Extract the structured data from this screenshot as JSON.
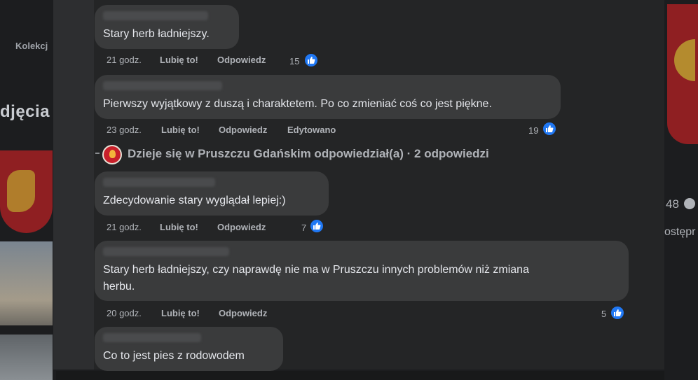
{
  "background": {
    "left_nav": {
      "kolekcje": "Kolekcj",
      "zdjecia": "djęcia"
    },
    "right": {
      "count": "48",
      "label": "ostępr"
    }
  },
  "comments": [
    {
      "text": "Stary herb ładniejszy.",
      "time": "21 godz.",
      "like": "Lubię to!",
      "reply": "Odpowiedz",
      "edited": "",
      "reactions": "15"
    },
    {
      "text": "Pierwszy wyjątkowy z duszą i charaktetem. Po co zmieniać coś co jest piękne.",
      "time": "23 godz.",
      "like": "Lubię to!",
      "reply": "Odpowiedz",
      "edited": "Edytowano",
      "reactions": "19"
    },
    {
      "text": "Zdecydowanie stary wyglądał lepiej:)",
      "time": "21 godz.",
      "like": "Lubię to!",
      "reply": "Odpowiedz",
      "edited": "",
      "reactions": "7"
    },
    {
      "text_line1": "Stary herb ładniejszy, czy naprawdę nie ma w Pruszczu innych problemów niż zmiana",
      "text_line2": "herbu.",
      "time": "20 godz.",
      "like": "Lubię to!",
      "reply": "Odpowiedz",
      "edited": "",
      "reactions": "5"
    },
    {
      "text": "Co to jest pies z rodowodem"
    }
  ],
  "replies_summary": {
    "text": "Dzieje się w Pruszczu Gdańskim odpowiedział(a) · 2 odpowiedzi"
  },
  "colors": {
    "accent": "#2078f4",
    "bubble": "#3a3b3c",
    "panel": "#242526",
    "meta": "#b0b3b8"
  },
  "icons": {
    "like": "thumbs-up-icon"
  }
}
